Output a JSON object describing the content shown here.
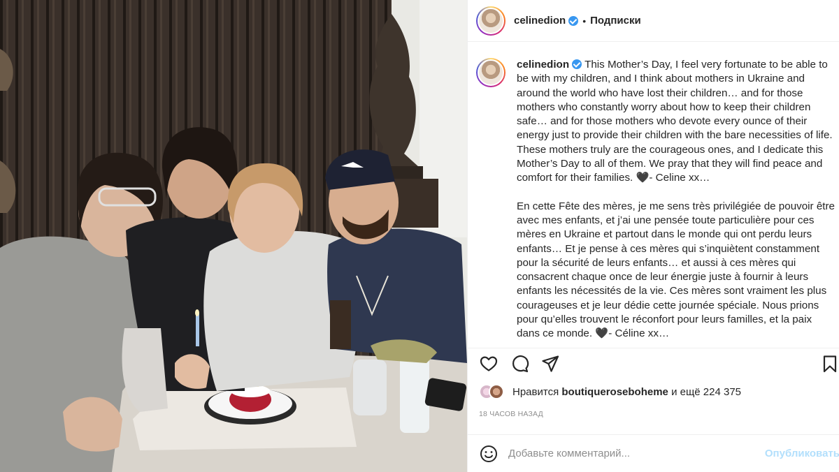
{
  "post_header": {
    "username": "celinedion",
    "separator": "•",
    "follow_label": "Подписки"
  },
  "caption": {
    "username": "celinedion",
    "english": "This Mother’s Day, I feel very fortunate to be able to be with my children, and I think about mothers in Ukraine and around the world who have lost their children… and for those mothers who constantly worry about how to keep their children safe… and for those mothers who devote every ounce of their energy just to provide their children with the bare necessities of life. These mothers truly are the courageous ones, and I dedicate this Mother’s Day to all of them. We pray that they will find peace and comfort for their families. 🖤- Celine xx…",
    "french": "En cette Fête des mères, je me sens très privilégiée de pouvoir être avec mes enfants, et j’ai une pensée toute particulière pour ces mères en Ukraine et partout dans le monde qui ont perdu leurs enfants… Et je pense à ces mères qui s’inquiètent constamment pour la sécurité de leurs enfants… et aussi à ces mères qui consacrent chaque once de leur énergie juste à fournir à leurs enfants les nécessités de la vie. Ces mères sont vraiment les plus courageuses et je leur dédie cette journée spéciale. Nous prions pour qu’elles trouvent le réconfort pour leurs familles, et la paix dans ce monde. 🖤- Céline xx…"
  },
  "actions": {
    "icons": [
      "heart-icon",
      "comment-icon",
      "share-icon",
      "bookmark-icon"
    ]
  },
  "likes": {
    "prefix": "Нравится",
    "user": "boutiqueroseboheme",
    "suffix": "и ещё 224 375"
  },
  "timestamp": "18 ЧАСОВ НАЗАД",
  "comment": {
    "placeholder": "Добавьте комментарий...",
    "publish_label": "Опубликовать"
  },
  "colors": {
    "verified_badge": "#3897f0",
    "publish_disabled": "#b2dffc",
    "muted_text": "#8e8e8e",
    "border": "#efefef"
  }
}
